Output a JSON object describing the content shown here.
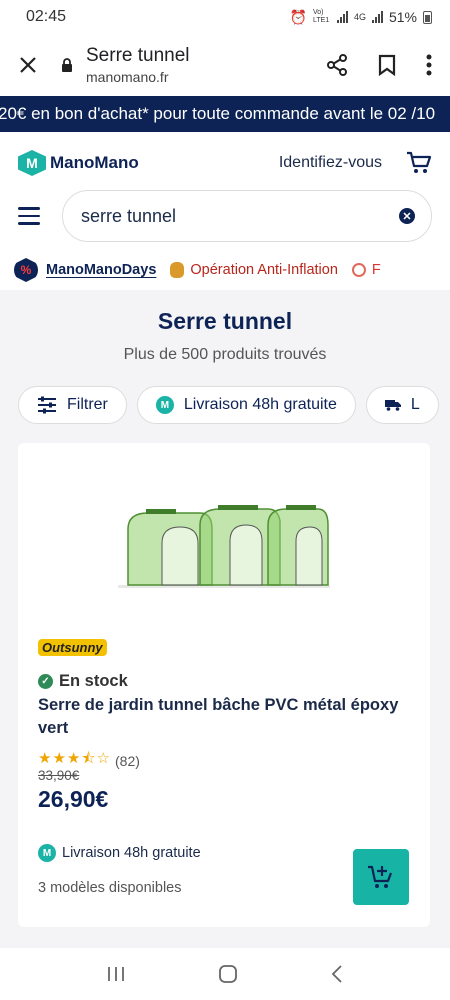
{
  "status_bar": {
    "time": "02:45",
    "battery": "51%",
    "network": "4G",
    "volte": "Vo) LTE1"
  },
  "browser": {
    "title": "Serre tunnel",
    "url": "manomano.fr"
  },
  "promo_banner": {
    "text": "20€ en bon d'achat* pour toute commande avant le 02 /10"
  },
  "header": {
    "logo_text": "ManoMano",
    "login_label": "Identifiez-vous",
    "search": {
      "value": "serre tunnel"
    },
    "quick_links": [
      {
        "label": "ManoManoDays"
      },
      {
        "label": "Opération Anti-Inflation"
      },
      {
        "label": "F"
      }
    ]
  },
  "results": {
    "title": "Serre tunnel",
    "count_text": "Plus de 500 produits trouvés"
  },
  "filters": [
    {
      "label": "Filtrer"
    },
    {
      "label": "Livraison 48h gratuite"
    },
    {
      "label": "L"
    }
  ],
  "product": {
    "brand": "Outsunny",
    "stock": "En stock",
    "name": "Serre de jardin tunnel bâche PVC métal époxy vert",
    "rating": 3.5,
    "stars": "★★★⯪☆",
    "reviews": "(82)",
    "old_price": "33,90€",
    "price": "26,90€",
    "delivery": "Livraison 48h gratuite",
    "models": "3 modèles disponibles"
  },
  "colors": {
    "brand_navy": "#0d2356",
    "accent_teal": "#17b3a5",
    "promo_red": "#b8261b"
  }
}
